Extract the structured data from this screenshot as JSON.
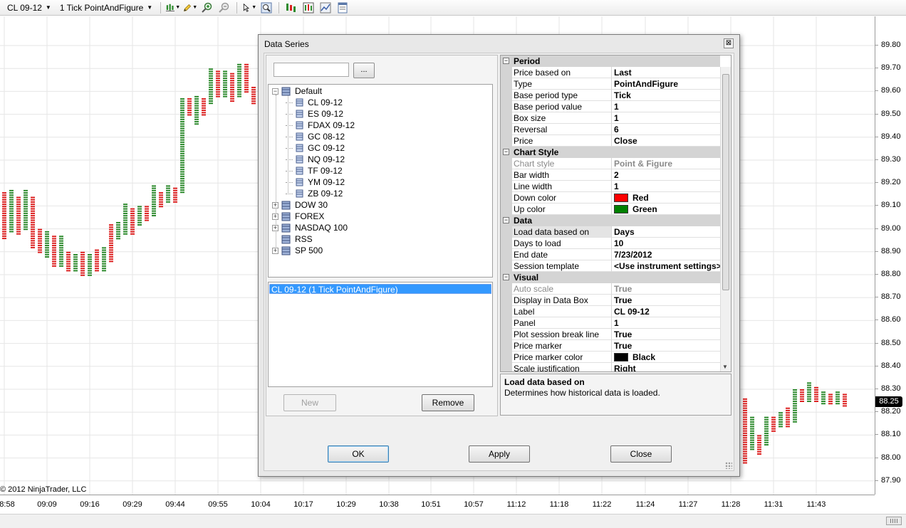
{
  "toolbar": {
    "instrument": "CL 09-12",
    "period": "1 Tick PointAndFigure",
    "icons": [
      "bar-chart-icon",
      "pencil-icon",
      "zoom-in-icon",
      "zoom-out-icon",
      "cursor-icon",
      "magnifier-icon",
      "data-series-icon",
      "strategies-icon",
      "indicators-icon",
      "properties-icon"
    ]
  },
  "chart": {
    "price_labels": [
      "89.80",
      "89.70",
      "89.60",
      "89.50",
      "89.40",
      "89.30",
      "89.20",
      "89.10",
      "89.00",
      "88.90",
      "88.80",
      "88.70",
      "88.60",
      "88.50",
      "88.40",
      "88.30",
      "88.20",
      "88.10",
      "88.00",
      "87.90"
    ],
    "time_labels": [
      "8:58",
      "09:09",
      "09:16",
      "09:29",
      "09:44",
      "09:55",
      "10:04",
      "10:17",
      "10:29",
      "10:38",
      "10:51",
      "10:57",
      "11:12",
      "11:18",
      "11:22",
      "11:24",
      "11:27",
      "11:28",
      "11:31",
      "11:43"
    ],
    "last_price": "88.25",
    "copyright": "© 2012 NinjaTrader, LLC",
    "up_color": "#2e8b2e",
    "down_color": "#dd2222",
    "grid_color": "#e6e6e6"
  },
  "dialog": {
    "title": "Data Series",
    "close_glyph": "⊠",
    "search_placeholder": "",
    "browse_label": "...",
    "tree": {
      "root": "Default",
      "children": [
        "CL 09-12",
        "ES 09-12",
        "FDAX 09-12",
        "GC 08-12",
        "GC 09-12",
        "NQ 09-12",
        "TF 09-12",
        "YM 09-12",
        "ZB 09-12"
      ],
      "groups": [
        "DOW 30",
        "FOREX",
        "NASDAQ 100",
        "RSS",
        "SP 500"
      ]
    },
    "series_item": "CL 09-12 (1 Tick PointAndFigure)",
    "new_label": "New",
    "remove_label": "Remove",
    "ok_label": "OK",
    "apply_label": "Apply",
    "close_label": "Close",
    "categories": {
      "period": "Period",
      "chart_style": "Chart Style",
      "data": "Data",
      "visual": "Visual"
    },
    "props": {
      "price_based_on": {
        "name": "Price based on",
        "value": "Last"
      },
      "type": {
        "name": "Type",
        "value": "PointAndFigure"
      },
      "base_period_type": {
        "name": "Base period type",
        "value": "Tick"
      },
      "base_period_value": {
        "name": "Base period value",
        "value": "1"
      },
      "box_size": {
        "name": "Box size",
        "value": "1"
      },
      "reversal": {
        "name": "Reversal",
        "value": "6"
      },
      "price": {
        "name": "Price",
        "value": "Close"
      },
      "chart_style": {
        "name": "Chart style",
        "value": "Point & Figure"
      },
      "bar_width": {
        "name": "Bar width",
        "value": "2"
      },
      "line_width": {
        "name": "Line width",
        "value": "1"
      },
      "down_color": {
        "name": "Down color",
        "value": "Red",
        "swatch": "#ff0000"
      },
      "up_color": {
        "name": "Up color",
        "value": "Green",
        "swatch": "#008000"
      },
      "load_data_based_on": {
        "name": "Load data based on",
        "value": "Days"
      },
      "days_to_load": {
        "name": "Days to load",
        "value": "10"
      },
      "end_date": {
        "name": "End date",
        "value": "7/23/2012"
      },
      "session_template": {
        "name": "Session template",
        "value": "<Use instrument settings>"
      },
      "auto_scale": {
        "name": "Auto scale",
        "value": "True"
      },
      "display_in_data_box": {
        "name": "Display in Data Box",
        "value": "True"
      },
      "label": {
        "name": "Label",
        "value": "CL 09-12"
      },
      "panel": {
        "name": "Panel",
        "value": "1"
      },
      "plot_session_break_line": {
        "name": "Plot session break line",
        "value": "True"
      },
      "price_marker": {
        "name": "Price marker",
        "value": "True"
      },
      "price_marker_color": {
        "name": "Price marker color",
        "value": "Black",
        "swatch": "#000000"
      },
      "scale_justification": {
        "name": "Scale justification",
        "value": "Right"
      }
    },
    "description": {
      "title": "Load data based on",
      "text": "Determines how historical data is loaded."
    }
  }
}
